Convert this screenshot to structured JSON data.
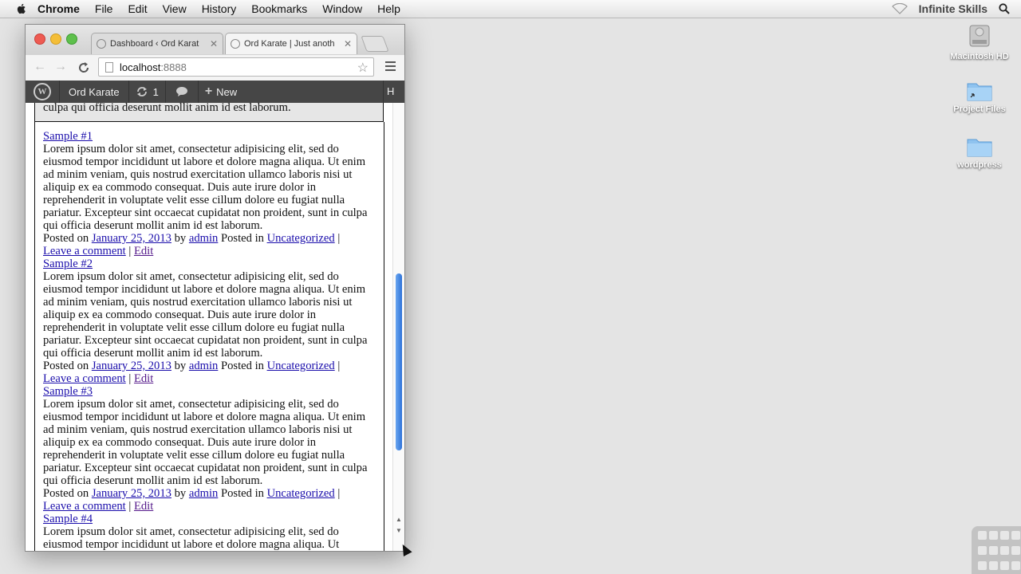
{
  "menubar": {
    "app": "Chrome",
    "items": [
      "File",
      "Edit",
      "View",
      "History",
      "Bookmarks",
      "Window",
      "Help"
    ],
    "user": "Infinite Skills"
  },
  "desktop": {
    "icons": [
      {
        "label": "Macintosh HD",
        "icon": "hard-drive-icon"
      },
      {
        "label": "Project Files",
        "icon": "folder-alias-icon"
      },
      {
        "label": "wordpress",
        "icon": "folder-icon"
      }
    ]
  },
  "browser": {
    "tabs": [
      {
        "title": "Dashboard ‹ Ord Karat",
        "active": false
      },
      {
        "title": "Ord Karate | Just anoth",
        "active": true
      }
    ],
    "url_host": "localhost",
    "url_port": ":8888"
  },
  "adminbar": {
    "site": "Ord Karate",
    "updates": "1",
    "new_label": "New",
    "cut": "H"
  },
  "page": {
    "prev_tail": "culpa qui officia deserunt mollit anim id est laborum.",
    "posts": [
      {
        "title": "Sample #1",
        "body": "Lorem ipsum dolor sit amet, consectetur adipisicing elit, sed do eiusmod tempor incididunt ut labore et dolore magna aliqua. Ut enim ad minim veniam, quis nostrud exercitation ullamco laboris nisi ut aliquip ex ea commodo consequat. Duis aute irure dolor in reprehenderit in voluptate velit esse cillum dolore eu fugiat nulla pariatur. Excepteur sint occaecat cupidatat non proident, sunt in culpa qui officia deserunt mollit anim id est laborum.",
        "posted_on": "Posted on",
        "date": "January 25, 2013",
        "by": "by",
        "author": "admin",
        "posted_in": "Posted in",
        "category": "Uncategorized",
        "comment": "Leave a comment",
        "edit": "Edit"
      },
      {
        "title": "Sample #2",
        "body": "Lorem ipsum dolor sit amet, consectetur adipisicing elit, sed do eiusmod tempor incididunt ut labore et dolore magna aliqua. Ut enim ad minim veniam, quis nostrud exercitation ullamco laboris nisi ut aliquip ex ea commodo consequat. Duis aute irure dolor in reprehenderit in voluptate velit esse cillum dolore eu fugiat nulla pariatur. Excepteur sint occaecat cupidatat non proident, sunt in culpa qui officia deserunt mollit anim id est laborum.",
        "posted_on": "Posted on",
        "date": "January 25, 2013",
        "by": "by",
        "author": "admin",
        "posted_in": "Posted in",
        "category": "Uncategorized",
        "comment": "Leave a comment",
        "edit": "Edit"
      },
      {
        "title": "Sample #3",
        "body": "Lorem ipsum dolor sit amet, consectetur adipisicing elit, sed do eiusmod tempor incididunt ut labore et dolore magna aliqua. Ut enim ad minim veniam, quis nostrud exercitation ullamco laboris nisi ut aliquip ex ea commodo consequat. Duis aute irure dolor in reprehenderit in voluptate velit esse cillum dolore eu fugiat nulla pariatur. Excepteur sint occaecat cupidatat non proident, sunt in culpa qui officia deserunt mollit anim id est laborum.",
        "posted_on": "Posted on",
        "date": "January 25, 2013",
        "by": "by",
        "author": "admin",
        "posted_in": "Posted in",
        "category": "Uncategorized",
        "comment": "Leave a comment",
        "edit": "Edit"
      },
      {
        "title": "Sample #4",
        "body": "Lorem ipsum dolor sit amet, consectetur adipisicing elit, sed do eiusmod tempor incididunt ut labore et dolore magna aliqua. Ut"
      }
    ]
  }
}
